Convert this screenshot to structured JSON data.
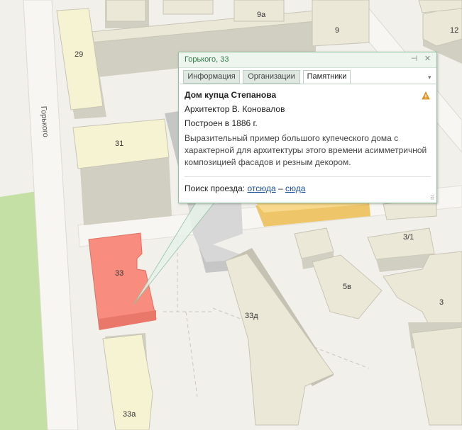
{
  "map": {
    "street_label": "Горького",
    "buildings": {
      "b29": "29",
      "b31": "31",
      "b33": "33",
      "b33a": "33а",
      "b33d": "33д",
      "b9a": "9а",
      "b9": "9",
      "b12": "12",
      "b5v": "5в",
      "b3_1": "3/1",
      "b3": "3"
    },
    "colors": {
      "background": "#f1f0eb",
      "park": "#c4e0a4",
      "building_top": "#ebe8d8",
      "building_side": "#d1cfc1",
      "selected": "#f88c7e",
      "yellow": "#f8d98c",
      "gray": "#c6c6c6"
    }
  },
  "popup": {
    "title": "Горького, 33",
    "pin_icon": "pin-icon",
    "close_icon": "close-icon",
    "tabs": [
      "Информация",
      "Организации",
      "Памятники"
    ],
    "active_tab": 2,
    "name": "Дом купца Степанова",
    "architect": "Архитектор В. Коновалов",
    "built": "Построен в 1886 г.",
    "description": "Выразительный пример большого купеческого дома с характерной для архитектуры этого времени асимметричной композицией фасадов и резным декором.",
    "route_label": "Поиск проезда:",
    "route_from": "отсюда",
    "route_dash": "–",
    "route_to": "сюда"
  }
}
